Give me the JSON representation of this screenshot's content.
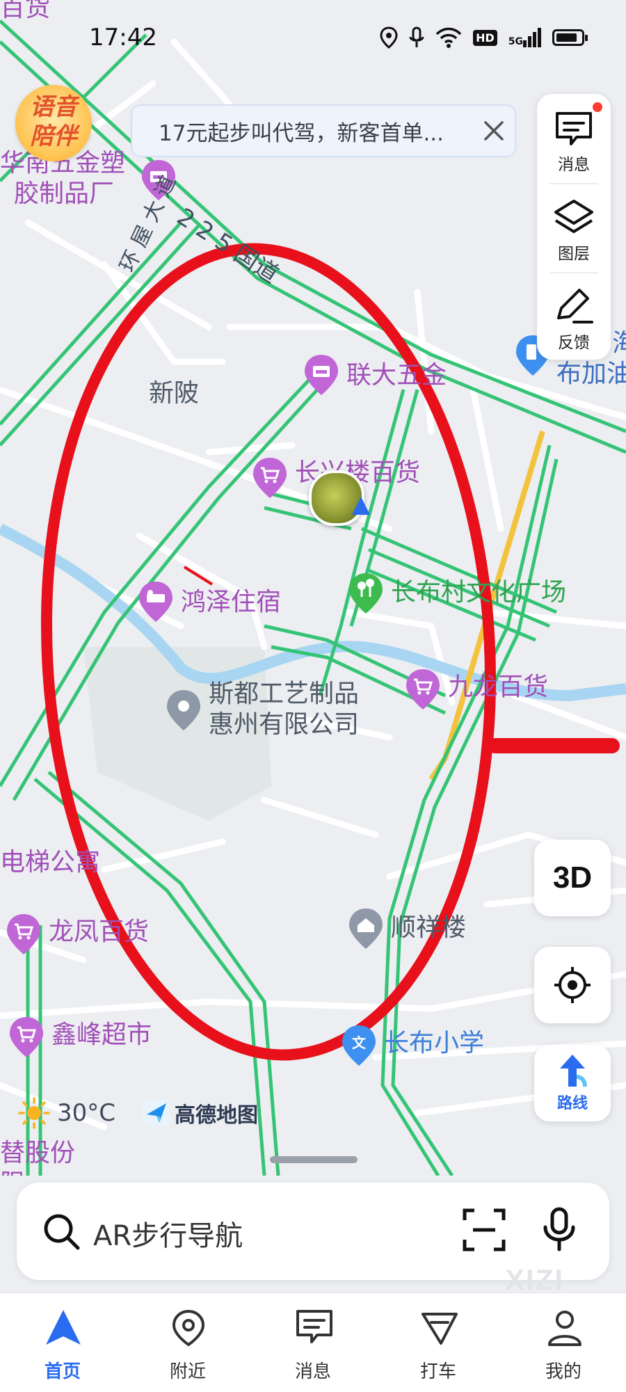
{
  "status_bar": {
    "time": "17:42",
    "icons": [
      "location-icon",
      "mic-icon",
      "wifi-icon",
      "hd-badge",
      "5g-signal-icon",
      "battery-icon"
    ],
    "hd_label": "HD",
    "network_label": "5G",
    "battery_level": 0.85
  },
  "voice_companion": {
    "line1": "语音",
    "line2": "陪伴"
  },
  "promo_banner": {
    "text": "17元起步叫代驾，新客首单..."
  },
  "right_panel": {
    "messages_label": "消息",
    "layers_label": "图层",
    "feedback_label": "反馈"
  },
  "map": {
    "poi": {
      "hardware_plastics_l1": "华南五金塑",
      "hardware_plastics_l2": "胶制品厂",
      "liantai": "联大五金",
      "changxing": "长兴楼百货",
      "hongze": "鸿泽住宿",
      "culture_square": "长布村文化广场",
      "jiulong": "九龙百货",
      "sidu_l1": "斯都工艺制品",
      "sidu_l2": "惠州有限公司",
      "elevator_apt": "电梯公寓",
      "longfeng": "龙凤百货",
      "shunxiang": "顺祥楼",
      "xinfeng": "鑫峰超市",
      "changbu_school": "长布小学",
      "gas_station_l1": "海",
      "gas_station_l2": "布加油",
      "topleft_partial": "百货",
      "bottomleft_l1": "替股份",
      "bottomleft_l2": "限"
    },
    "area_labels": {
      "xinling": "新陂"
    },
    "road_labels": {
      "national_road": "2 2 5 国道",
      "avenue": "环 屋 大 道"
    },
    "colors": {
      "road_green": "#35c475",
      "road_yellow": "#f3c33e",
      "river": "#a8d6f2",
      "annotation_red": "#e8101a"
    }
  },
  "map_controls": {
    "btn_3d": "3D",
    "route_label": "路线"
  },
  "weather": {
    "temperature": "30°C"
  },
  "brand": {
    "name": "高德地图"
  },
  "search": {
    "placeholder": "AR步行导航"
  },
  "watermark": "XIZI",
  "tab_bar": {
    "tabs": [
      {
        "label": "首页",
        "icon": "navigation-arrow-icon",
        "active": true
      },
      {
        "label": "附近",
        "icon": "location-pin-icon",
        "active": false
      },
      {
        "label": "消息",
        "icon": "chat-icon",
        "active": false
      },
      {
        "label": "打车",
        "icon": "taxi-icon",
        "active": false
      },
      {
        "label": "我的",
        "icon": "person-icon",
        "active": false
      }
    ]
  }
}
